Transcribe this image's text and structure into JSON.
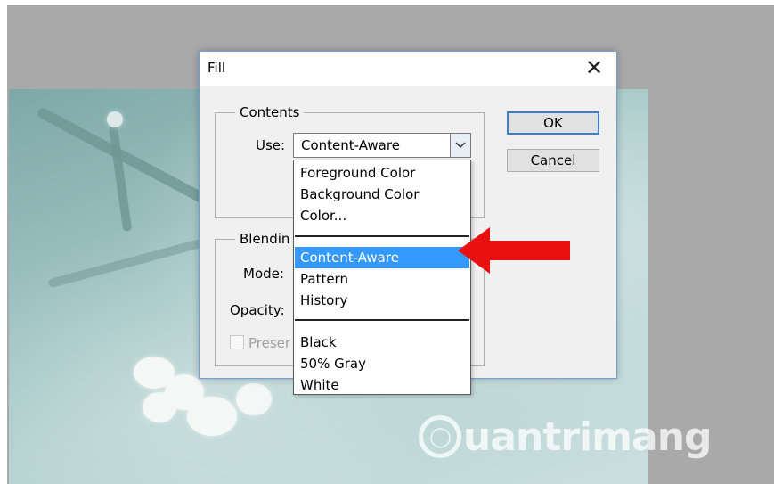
{
  "dialog": {
    "title": "Fill",
    "ok_label": "OK",
    "cancel_label": "Cancel",
    "contents_legend": "Contents",
    "use_label": "Use:",
    "use_value": "Content-Aware",
    "blending_legend": "Blendin",
    "mode_label": "Mode:",
    "opacity_label": "Opacity:",
    "preserve_label": "Preser"
  },
  "dropdown": {
    "group1": [
      "Foreground Color",
      "Background Color",
      "Color..."
    ],
    "group2": [
      "Content-Aware",
      "Pattern",
      "History"
    ],
    "group3": [
      "Black",
      "50% Gray",
      "White"
    ],
    "selected": "Content-Aware"
  },
  "watermark": {
    "text": "uantrimang"
  },
  "colors": {
    "selection": "#3399ff",
    "default_button_border": "#3c7fd1",
    "annotation_arrow": "#e81010",
    "workspace": "#a9a9a9"
  },
  "icons": {
    "close": "close-icon",
    "dropdown": "chevron-down-icon",
    "annotation": "red-arrow-icon",
    "watermark": "lightbulb-icon"
  }
}
